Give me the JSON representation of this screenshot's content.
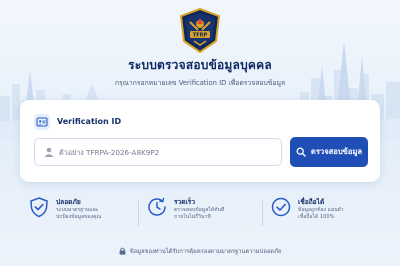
{
  "header": {
    "logo_text": "TFRP",
    "title": "ระบบตรวจสอบข้อมูลบุคคล",
    "subtitle": "กรุณากรอกหมายเลข Verification ID เพื่อตรวจสอบข้อมูล"
  },
  "card": {
    "icon": "id-card-icon",
    "title": "Verification ID",
    "input": {
      "value": "",
      "placeholder": "ตัวอย่าง TFRPA-2026-A8K9P2",
      "icon": "user-icon"
    },
    "button": {
      "label": "ตรวจสอบข้อมูล",
      "icon": "search-icon"
    }
  },
  "features": [
    {
      "icon": "shield-check-icon",
      "title": "ปลอดภัย",
      "line1": "ระบบมาตรฐานและ",
      "line2": "ปกป้องข้อมูลของคุณ"
    },
    {
      "icon": "clock-icon",
      "title": "รวดเร็ว",
      "line1": "ตรวจสอบข้อมูลได้ทันที",
      "line2": "ภายในไม่กี่วินาที"
    },
    {
      "icon": "check-circle-icon",
      "title": "เชื่อถือได้",
      "line1": "ข้อมูลถูกต้อง แม่นยำ",
      "line2": "เชื่อถือได้ 100%"
    }
  ],
  "footer": {
    "icon": "lock-icon",
    "text": "ข้อมูลของท่านได้รับการคุ้มครองตามมาตรฐานความปลอดภัย"
  },
  "colors": {
    "primary": "#1f4fb6",
    "heading": "#102a66",
    "accent_gold": "#d7a12b",
    "background": "#eaf2fb"
  }
}
